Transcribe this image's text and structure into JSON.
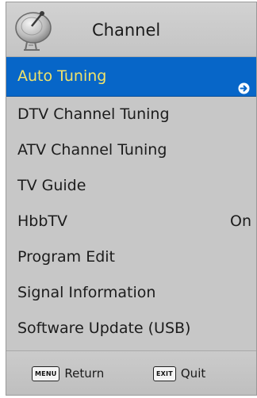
{
  "header": {
    "title": "Channel",
    "icon": "satellite-dish-icon"
  },
  "menu": {
    "items": [
      {
        "label": "Auto Tuning",
        "selected": true,
        "icon": "arrow-right-circle-icon"
      },
      {
        "label": "DTV Channel Tuning"
      },
      {
        "label": "ATV Channel Tuning"
      },
      {
        "label": "TV Guide"
      },
      {
        "label": "HbbTV",
        "value": "On"
      },
      {
        "label": "Program Edit"
      },
      {
        "label": "Signal Information"
      },
      {
        "label": "Software Update (USB)"
      }
    ]
  },
  "footer": {
    "return_key": "MENU",
    "return_label": "Return",
    "quit_key": "EXIT",
    "quit_label": "Quit"
  },
  "colors": {
    "selection_background": "#0766c8",
    "selection_text": "#f0e36a",
    "menu_background": "#c7c7c7"
  }
}
